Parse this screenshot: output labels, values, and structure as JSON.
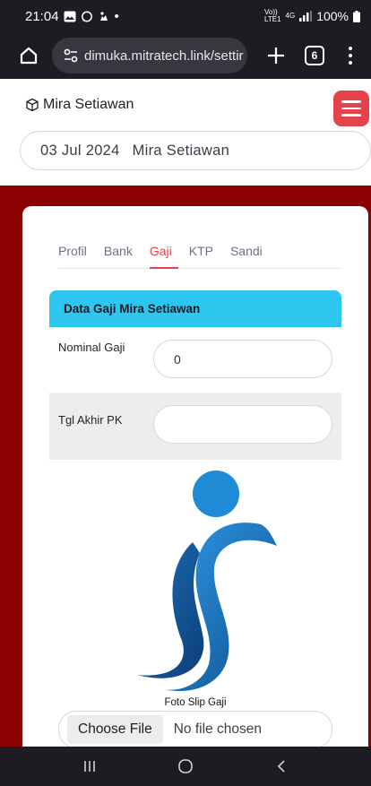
{
  "status_bar": {
    "time": "21:04",
    "extra_dot": "•",
    "network_top": "Vo))",
    "network_bottom": "LTE1",
    "network_type": "4G",
    "battery": "100%"
  },
  "browser": {
    "url": "dimuka.mitratech.link/settir",
    "tab_count": "6"
  },
  "header": {
    "brand": "Mira Setiawan"
  },
  "date_bar": {
    "date": "03 Jul 2024",
    "name": "Mira Setiawan"
  },
  "tabs": [
    {
      "label": "Profil",
      "active": false
    },
    {
      "label": "Bank",
      "active": false
    },
    {
      "label": "Gaji",
      "active": true
    },
    {
      "label": "KTP",
      "active": false
    },
    {
      "label": "Sandi",
      "active": false
    }
  ],
  "salary_section": {
    "title": "Data Gaji Mira Setiawan",
    "nominal_label": "Nominal Gaji",
    "nominal_value": "0",
    "pk_label": "Tgl Akhir PK",
    "pk_value": ""
  },
  "slip": {
    "caption": "Foto Slip Gaji",
    "choose_label": "Choose File",
    "no_file_label": "No file chosen"
  },
  "colors": {
    "accent": "#e5434b",
    "header_bg": "#2ec6ef",
    "maroon": "#8b0000",
    "logo_dark": "#1b5a9a",
    "logo_light": "#1f8ad6"
  },
  "icons": [
    "image-icon",
    "whatsapp-icon",
    "cloud-icon",
    "signal-icon",
    "battery-icon",
    "home-icon",
    "tune-icon",
    "plus-icon",
    "tabs-icon",
    "more-icon",
    "cube-icon",
    "menu-icon",
    "recents-icon",
    "home-nav-icon",
    "back-icon"
  ]
}
